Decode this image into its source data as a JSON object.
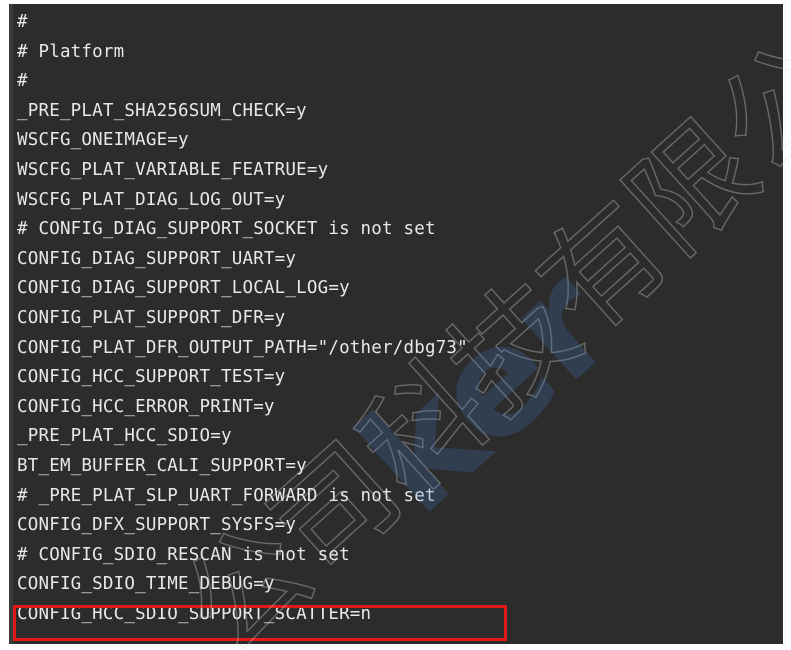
{
  "editor": {
    "lines": [
      "#",
      "# Platform",
      "#",
      "_PRE_PLAT_SHA256SUM_CHECK=y",
      "WSCFG_ONEIMAGE=y",
      "WSCFG_PLAT_VARIABLE_FEATRUE=y",
      "WSCFG_PLAT_DIAG_LOG_OUT=y",
      "# CONFIG_DIAG_SUPPORT_SOCKET is not set",
      "CONFIG_DIAG_SUPPORT_UART=y",
      "CONFIG_DIAG_SUPPORT_LOCAL_LOG=y",
      "CONFIG_PLAT_SUPPORT_DFR=y",
      "CONFIG_PLAT_DFR_OUTPUT_PATH=\"/other/dbg73\"",
      "CONFIG_HCC_SUPPORT_TEST=y",
      "CONFIG_HCC_ERROR_PRINT=y",
      "_PRE_PLAT_HCC_SDIO=y",
      "BT_EM_BUFFER_CALI_SUPPORT=y",
      "# _PRE_PLAT_SLP_UART_FORWARD is not set",
      "CONFIG_DFX_SUPPORT_SYSFS=y",
      "# CONFIG_SDIO_RESCAN is not set",
      "CONFIG_SDIO_TIME_DEBUG=y",
      "CONFIG_HCC_SDIO_SUPPORT_SCATTER=n"
    ],
    "highlighted_line_index": 20
  },
  "colors": {
    "background": "#2c2c2c",
    "text": "#e8e8e8",
    "highlight_border": "#e11919"
  },
  "watermark": {
    "text": "ker",
    "cjk_text": "公司科技有限公"
  }
}
